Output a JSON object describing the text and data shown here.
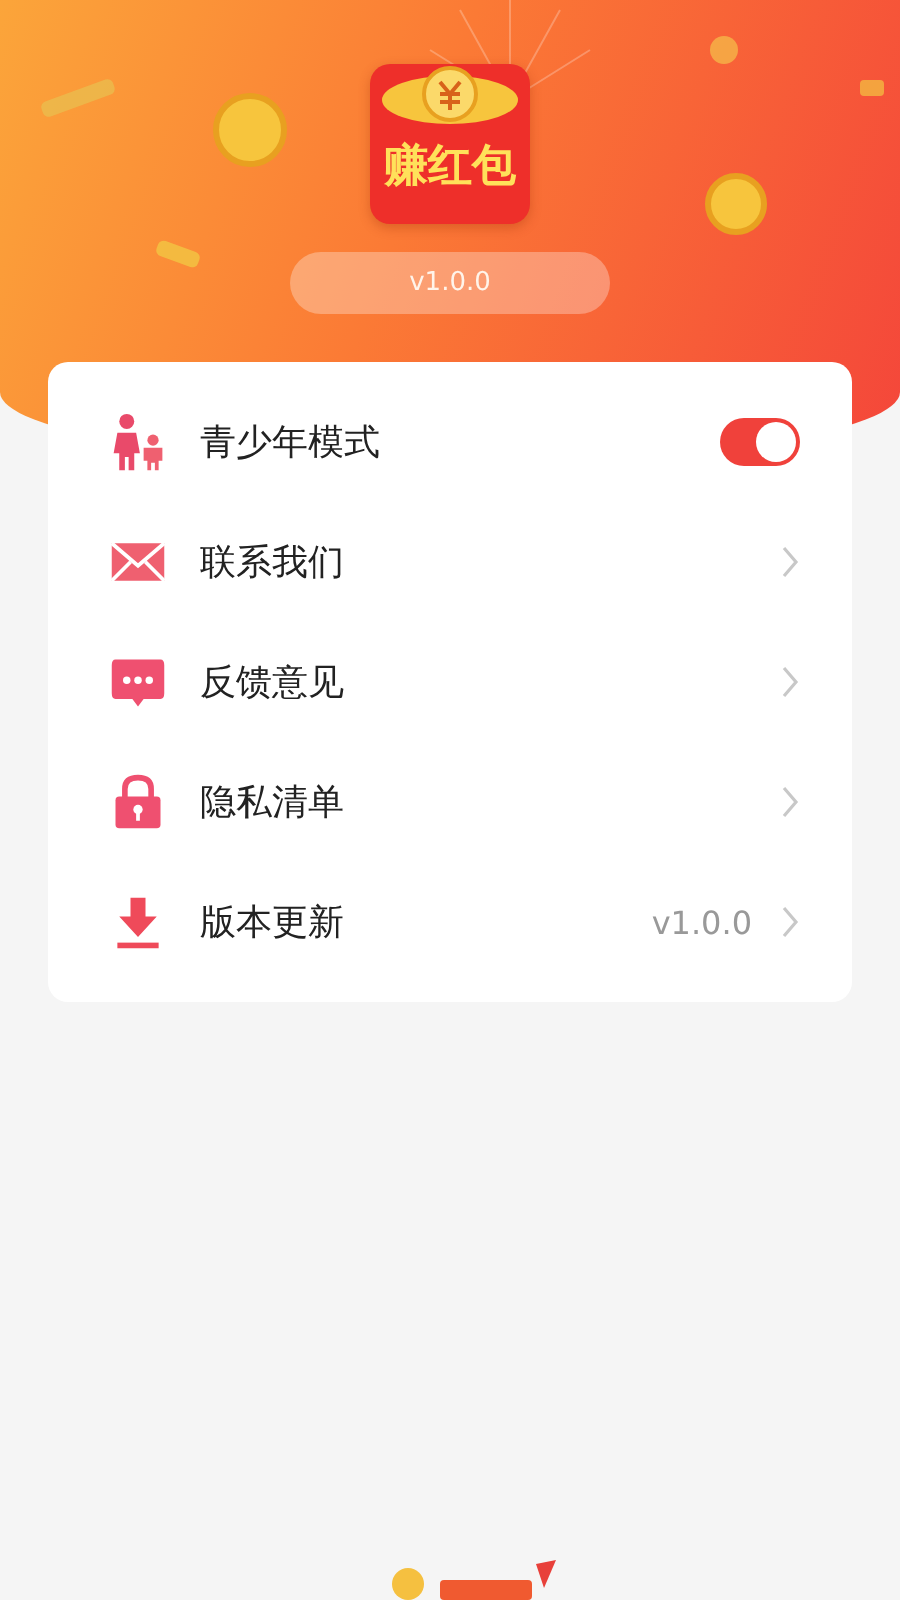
{
  "header": {
    "logo_text": "赚红包",
    "version": "v1.0.0"
  },
  "menu": [
    {
      "kind": "toggle",
      "label": "青少年模式",
      "on": true
    },
    {
      "kind": "link",
      "label": "联系我们"
    },
    {
      "kind": "link",
      "label": "反馈意见"
    },
    {
      "kind": "link",
      "label": "隐私清单"
    },
    {
      "kind": "link",
      "label": "版本更新",
      "value": "v1.0.0"
    }
  ]
}
